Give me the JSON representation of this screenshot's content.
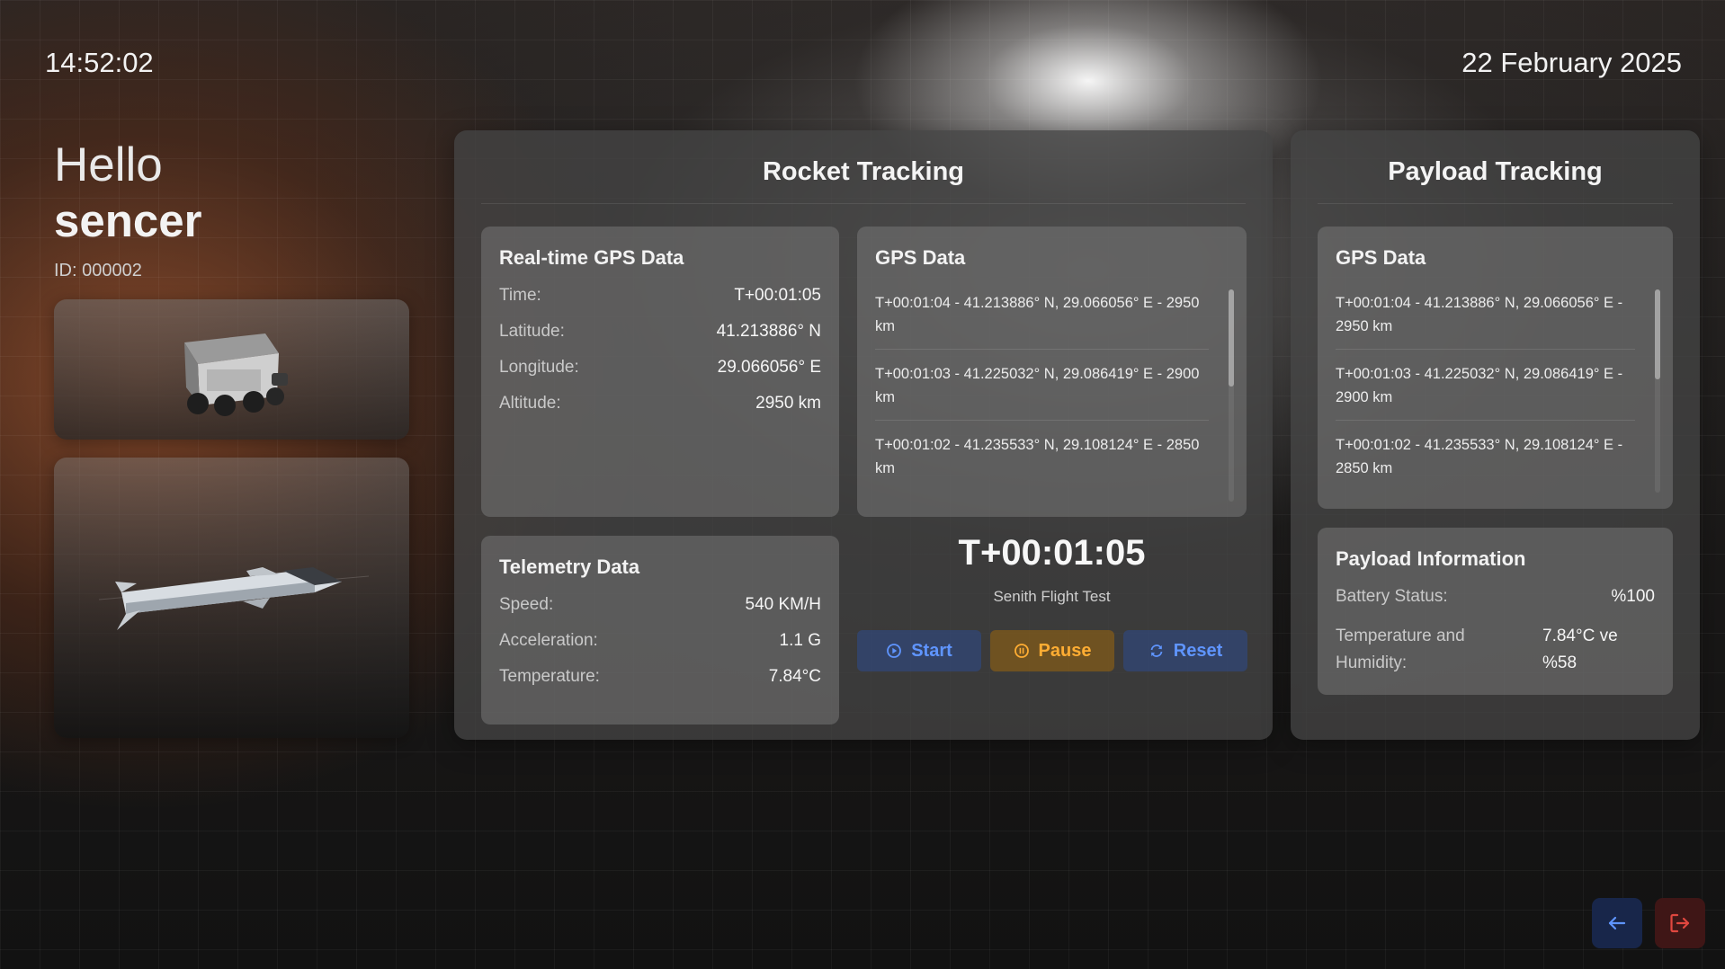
{
  "header": {
    "time": "14:52:02",
    "date": "22 February 2025"
  },
  "user": {
    "greeting": "Hello",
    "name": "sencer",
    "id_label": "ID: 000002"
  },
  "media": {
    "rover_icon": "rover-image",
    "rocket_icon": "rocket-image"
  },
  "rocket_tracking": {
    "title": "Rocket Tracking",
    "realtime_gps": {
      "title": "Real-time GPS Data",
      "rows": [
        {
          "label": "Time:",
          "value": "T+00:01:05"
        },
        {
          "label": "Latitude:",
          "value": "41.213886° N"
        },
        {
          "label": "Longitude:",
          "value": "29.066056° E"
        },
        {
          "label": "Altitude:",
          "value": "2950 km"
        }
      ]
    },
    "gps_data": {
      "title": "GPS Data",
      "items": [
        "T+00:01:04 - 41.213886° N, 29.066056° E - 2950 km",
        "T+00:01:03 - 41.225032° N, 29.086419° E - 2900 km",
        "T+00:01:02 - 41.235533° N, 29.108124° E - 2850 km"
      ]
    },
    "telemetry": {
      "title": "Telemetry Data",
      "rows": [
        {
          "label": "Speed:",
          "value": "540 KM/H"
        },
        {
          "label": "Acceleration:",
          "value": "1.1 G"
        },
        {
          "label": "Temperature:",
          "value": "7.84°C"
        }
      ]
    },
    "timer": {
      "value": "T+00:01:05",
      "subtitle": "Senith Flight Test"
    },
    "controls": {
      "start_label": "Start",
      "pause_label": "Pause",
      "reset_label": "Reset"
    }
  },
  "payload_tracking": {
    "title": "Payload Tracking",
    "gps_data": {
      "title": "GPS Data",
      "items": [
        "T+00:01:04 - 41.213886° N, 29.066056° E - 2950 km",
        "T+00:01:03 - 41.225032° N, 29.086419° E - 2900 km",
        "T+00:01:02 - 41.235533° N, 29.108124° E - 2850 km"
      ]
    },
    "info": {
      "title": "Payload Information",
      "battery_label": "Battery Status:",
      "battery_value": "%100",
      "temp_label": "Temperature and Humidity:",
      "temp_value": "7.84°C ve %58"
    }
  },
  "colors": {
    "battery_ok": "#2dbb74",
    "primary_blue": "#5f95ff",
    "pause_orange": "#ffad33",
    "logout_red": "#e0473f"
  }
}
